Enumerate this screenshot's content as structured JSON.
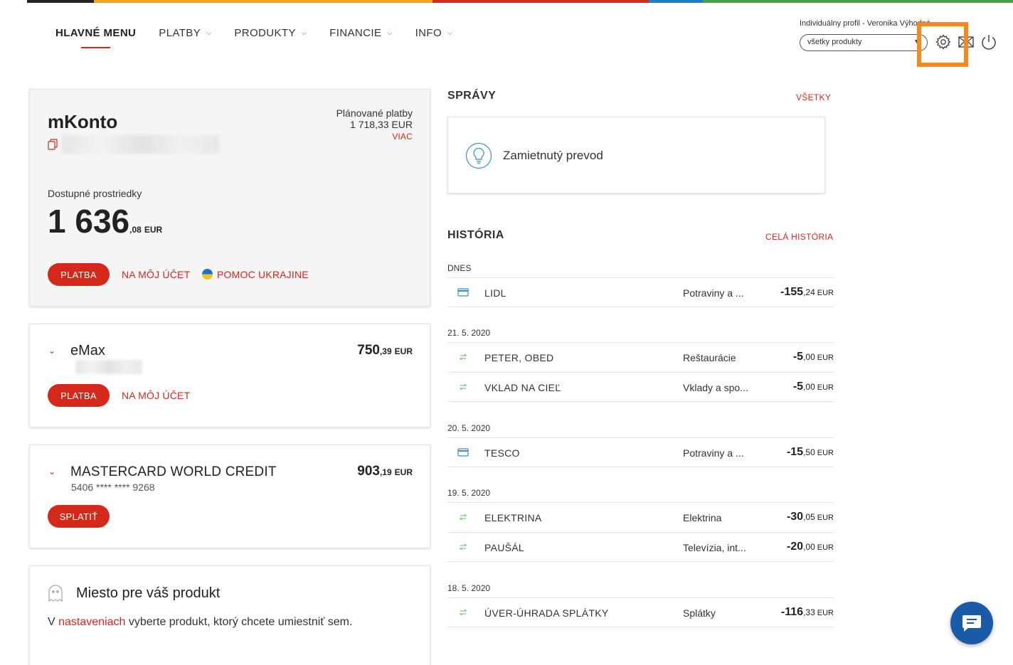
{
  "colors": {
    "brand_red": "#d5281b",
    "strip": [
      "#222222",
      "#f7a21b",
      "#d5281b",
      "#1a7fc7",
      "#43a047"
    ],
    "highlight": "#f7871f",
    "chat": "#1a5ba8"
  },
  "nav": {
    "items": [
      {
        "label": "HLAVNÉ MENU",
        "active": true
      },
      {
        "label": "PLATBY",
        "dropdown": true
      },
      {
        "label": "PRODUKTY",
        "dropdown": true
      },
      {
        "label": "FINANCIE",
        "dropdown": true
      },
      {
        "label": "INFO",
        "dropdown": true
      }
    ]
  },
  "topbar": {
    "profile_label": "Individuálny profil - Veronika Výhodná",
    "product_select": "všetky produkty",
    "icons": [
      "settings-icon",
      "mail-icon",
      "power-icon"
    ]
  },
  "mkonto": {
    "title": "mKonto",
    "planned_label": "Plánované platby",
    "planned_amount": "1 718,33 EUR",
    "more_link": "VIAC",
    "available_label": "Dostupné prostriedky",
    "balance_int": "1 636",
    "balance_dec": ",08",
    "currency": "EUR",
    "pay_button": "PLATBA",
    "to_account_link": "NA MÔJ ÚČET",
    "ukraine_link": "POMOC UKRAJINE"
  },
  "emax": {
    "title": "eMax",
    "amount_int": "750",
    "amount_dec": ",39",
    "currency": "EUR",
    "pay_button": "PLATBA",
    "to_account_link": "NA MÔJ ÚČET"
  },
  "mastercard": {
    "title": "MASTERCARD WORLD CREDIT",
    "card_number": "5406 **** **** 9268",
    "amount_int": "903",
    "amount_dec": ",19",
    "currency": "EUR",
    "repay_button": "SPLATIŤ"
  },
  "placeholder": {
    "title": "Miesto pre váš produkt",
    "text_before": "V ",
    "link": "nastaveniach",
    "text_after": " vyberte produkt, ktorý chcete umiestniť sem."
  },
  "messages": {
    "title": "SPRÁVY",
    "all_link": "VŠETKY",
    "item": "Zamietnutý prevod"
  },
  "history": {
    "title": "HISTÓRIA",
    "all_link": "CELÁ HISTÓRIA",
    "groups": [
      {
        "date": "DNES",
        "rows": [
          {
            "icon": "card",
            "name": "LIDL",
            "category": "Potraviny a ...",
            "amount_int": "-155",
            "amount_dec": ",24",
            "currency": "EUR"
          }
        ]
      },
      {
        "date": "21. 5. 2020",
        "rows": [
          {
            "icon": "transfer",
            "name": "PETER, OBED",
            "category": "Reštaurácie",
            "amount_int": "-5",
            "amount_dec": ",00",
            "currency": "EUR"
          },
          {
            "icon": "transfer",
            "name": "VKLAD NA CIEĽ",
            "category": "Vklady a spo...",
            "amount_int": "-5",
            "amount_dec": ",00",
            "currency": "EUR"
          }
        ]
      },
      {
        "date": "20. 5. 2020",
        "rows": [
          {
            "icon": "card",
            "name": "TESCO",
            "category": "Potraviny a ...",
            "amount_int": "-15",
            "amount_dec": ",50",
            "currency": "EUR"
          }
        ]
      },
      {
        "date": "19. 5. 2020",
        "rows": [
          {
            "icon": "transfer",
            "name": "ELEKTRINA",
            "category": "Elektrina",
            "amount_int": "-30",
            "amount_dec": ",05",
            "currency": "EUR"
          },
          {
            "icon": "transfer",
            "name": "PAUŠÁL",
            "category": "Televízia, int...",
            "amount_int": "-20",
            "amount_dec": ",00",
            "currency": "EUR"
          }
        ]
      },
      {
        "date": "18. 5. 2020",
        "rows": [
          {
            "icon": "transfer",
            "name": "ÚVER-ÚHRADA SPLÁTKY",
            "category": "Splátky",
            "amount_int": "-116",
            "amount_dec": ",33",
            "currency": "EUR"
          }
        ]
      }
    ]
  }
}
